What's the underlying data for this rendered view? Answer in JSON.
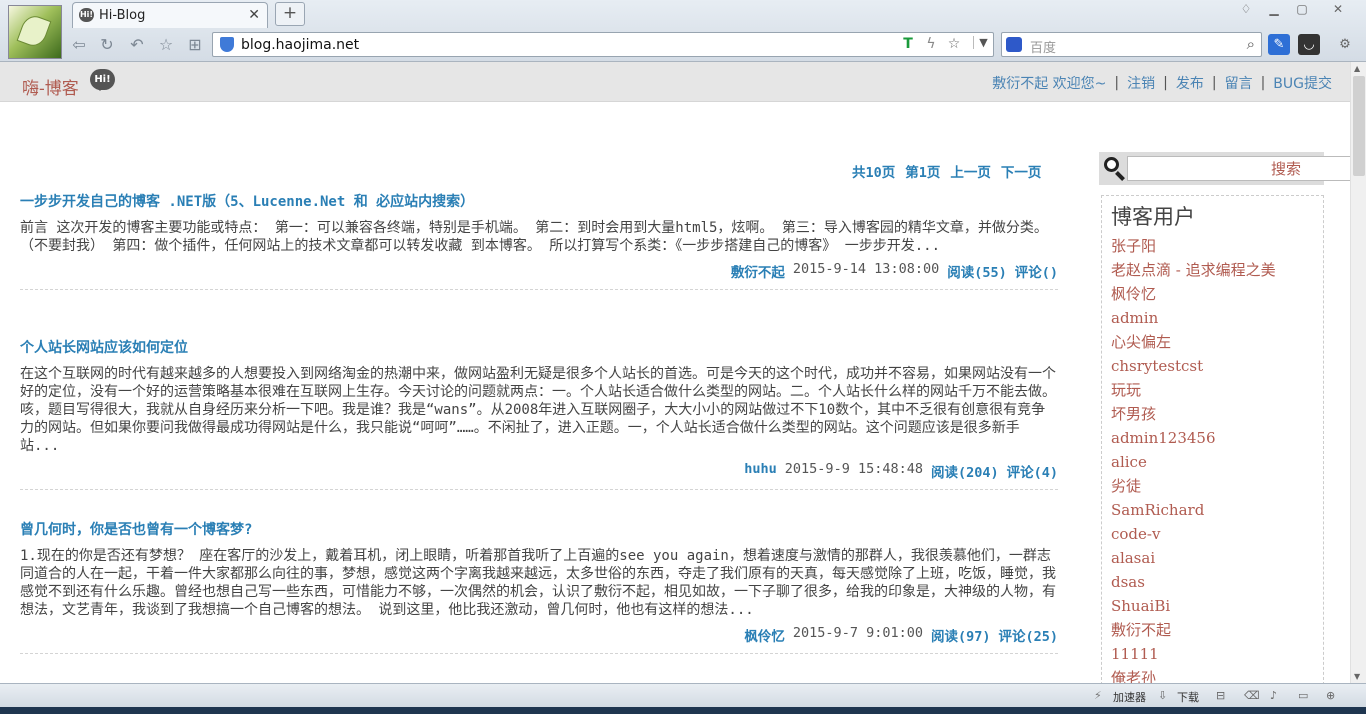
{
  "browser": {
    "tab_title": "Hi-Blog",
    "tab_favicon_text": "Hi!",
    "url": "blog.haojima.net",
    "search_placeholder": "百度"
  },
  "site": {
    "logo_text": "嗨-博客",
    "logo_badge": "Hi!",
    "nav": {
      "greeting": "敷衍不起 欢迎您~",
      "logout": "注销",
      "publish": "发布",
      "message": "留言",
      "bug_report": "BUG提交"
    }
  },
  "pager": {
    "total": "共10页",
    "current": "第1页",
    "prev": "上一页",
    "next": "下一页"
  },
  "posts": [
    {
      "title": "一步步开发自己的博客 .NET版（5、Lucenne.Net 和 必应站内搜索）",
      "excerpt": "前言 这次开发的博客主要功能或特点： 第一：可以兼容各终端，特别是手机端。 第二：到时会用到大量html5，炫啊。 第三：导入博客园的精华文章，并做分类。（不要封我） 第四：做个插件，任何网站上的技术文章都可以转发收藏 到本博客。 所以打算写个系类：《一步步搭建自己的博客》 一步步开发...",
      "author": "敷衍不起",
      "date": "2015-9-14 13:08:00",
      "reads": "阅读(55)",
      "comments": "评论()"
    },
    {
      "title": "个人站长网站应该如何定位",
      "excerpt": "在这个互联网的时代有越来越多的人想要投入到网络淘金的热潮中来，做网站盈利无疑是很多个人站长的首选。可是今天的这个时代，成功并不容易，如果网站没有一个好的定位，没有一个好的运营策略基本很难在互联网上生存。今天讨论的问题就两点：一。个人站长适合做什么类型的网站。二。个人站长什么样的网站千万不能去做。咳，题目写得很大，我就从自身经历来分析一下吧。我是谁？我是“wans”。从2008年进入互联网圈子，大大小小的网站做过不下10数个，其中不乏很有创意很有竞争力的网站。但如果你要问我做得最成功得网站是什么，我只能说“呵呵”……。不闲扯了，进入正题。一，个人站长适合做什么类型的网站。这个问题应该是很多新手站...",
      "author": "huhu",
      "date": "2015-9-9 15:48:48",
      "reads": "阅读(204)",
      "comments": "评论(4)"
    },
    {
      "title": "曾几何时，你是否也曾有一个博客梦?",
      "excerpt": "1.现在的你是否还有梦想？ 座在客厅的沙发上，戴着耳机，闭上眼睛，听着那首我听了上百遍的see you again，想着速度与激情的那群人，我很羡慕他们，一群志同道合的人在一起，干着一件大家都那么向往的事，梦想，感觉这两个字离我越来越远，太多世俗的东西，夺走了我们原有的天真，每天感觉除了上班，吃饭，睡觉，我感觉不到还有什么乐趣。曾经也想自己写一些东西，可惜能力不够，一次偶然的机会，认识了敷衍不起，相见如故，一下子聊了很多，给我的印象是，大神级的人物，有想法，文艺青年，我谈到了我想搞一个自己博客的想法。 说到这里，他比我还激动，曾几何时，他也有这样的想法...",
      "author": "枫伶忆",
      "date": "2015-9-7 9:01:00",
      "reads": "阅读(97)",
      "comments": "评论(25)"
    }
  ],
  "sidebar": {
    "search_button": "搜索",
    "users_title": "博客用户",
    "users": [
      "张子阳",
      "老赵点滴 - 追求编程之美",
      "枫伶忆",
      "admin",
      "心尖偏左",
      "chsrytestcst",
      "玩玩",
      "坏男孩",
      "admin123456",
      "alice",
      "劣徒",
      "SamRichard",
      "code-v",
      "alasai",
      "dsas",
      "ShuaiBi",
      "敷衍不起",
      "11111",
      "俺老孙"
    ]
  },
  "statusbar": {
    "accelerator": "加速器",
    "download": "下载"
  }
}
